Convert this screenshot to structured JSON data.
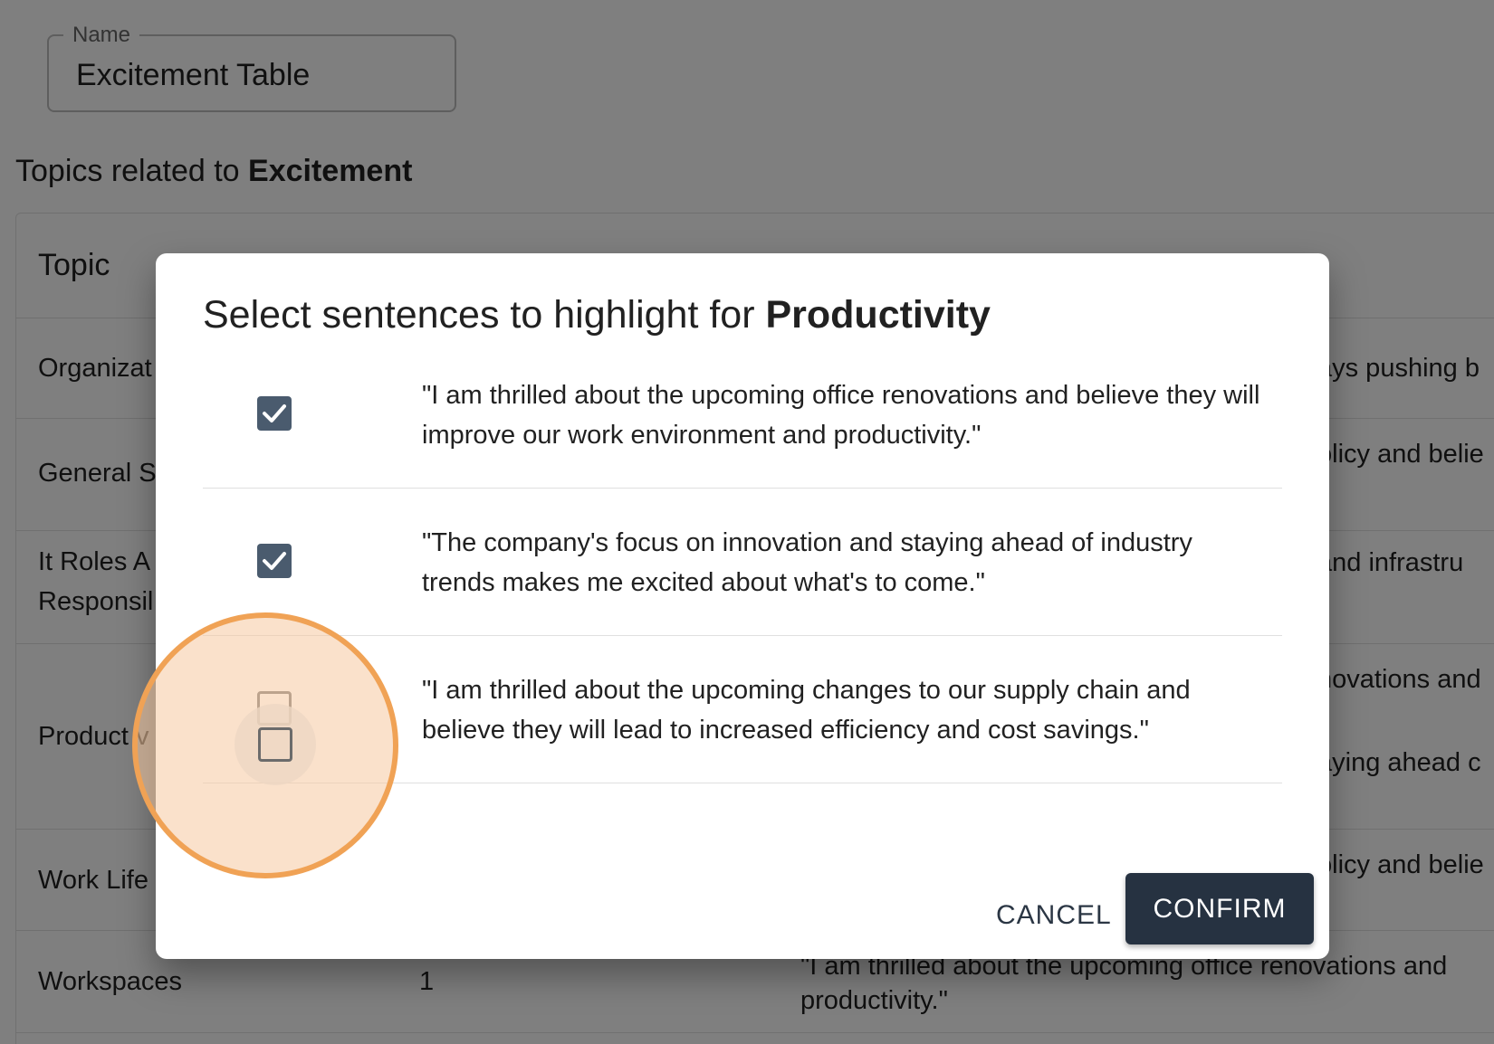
{
  "background": {
    "name_field": {
      "label": "Name",
      "value": "Excitement Table"
    },
    "topics_heading": {
      "prefix": "Topics related to ",
      "topic": "Excitement"
    },
    "table": {
      "header_topic": "Topic",
      "rows": [
        {
          "topic": "Organizat",
          "count": "",
          "sentence": "ays pushing b"
        },
        {
          "topic": "General S",
          "count": "",
          "sentence": "olicy and belie"
        },
        {
          "topic_line1": "It Roles A",
          "topic_line2": "Responsil",
          "count": "",
          "sentence": "and infrastru"
        },
        {
          "topic": "Product v",
          "count": "",
          "sentence_line1": "novations and",
          "sentence_line2": "aying ahead c"
        },
        {
          "topic": "Work Life",
          "count": "",
          "sentence": "olicy and belie"
        },
        {
          "topic": "Workspaces",
          "count": "1",
          "sentence_line1": "\"I am thrilled about the upcoming office renovations and",
          "sentence_line2": "productivity.\""
        }
      ]
    }
  },
  "dialog": {
    "title_prefix": "Select sentences to highlight for ",
    "title_topic": "Productivity",
    "options": [
      {
        "text": "\"I am thrilled about the upcoming office renovations and believe they will improve our work environment and productivity.\"",
        "checked": true
      },
      {
        "text": "\"The company's focus on innovation and staying ahead of industry trends makes me excited about what's to come.\"",
        "checked": true
      },
      {
        "text": "\"I am thrilled about the upcoming changes to our supply chain and believe they will lead to increased efficiency and cost savings.\"",
        "checked": false
      }
    ],
    "cancel_label": "CANCEL",
    "confirm_label": "CONFIRM"
  },
  "icons": {
    "checked": "check-icon",
    "unchecked": "empty-checkbox-icon"
  },
  "colors": {
    "checkbox_checked": "#4a5b6e",
    "confirm_button": "#263241",
    "click_highlight": "#f0a255"
  }
}
